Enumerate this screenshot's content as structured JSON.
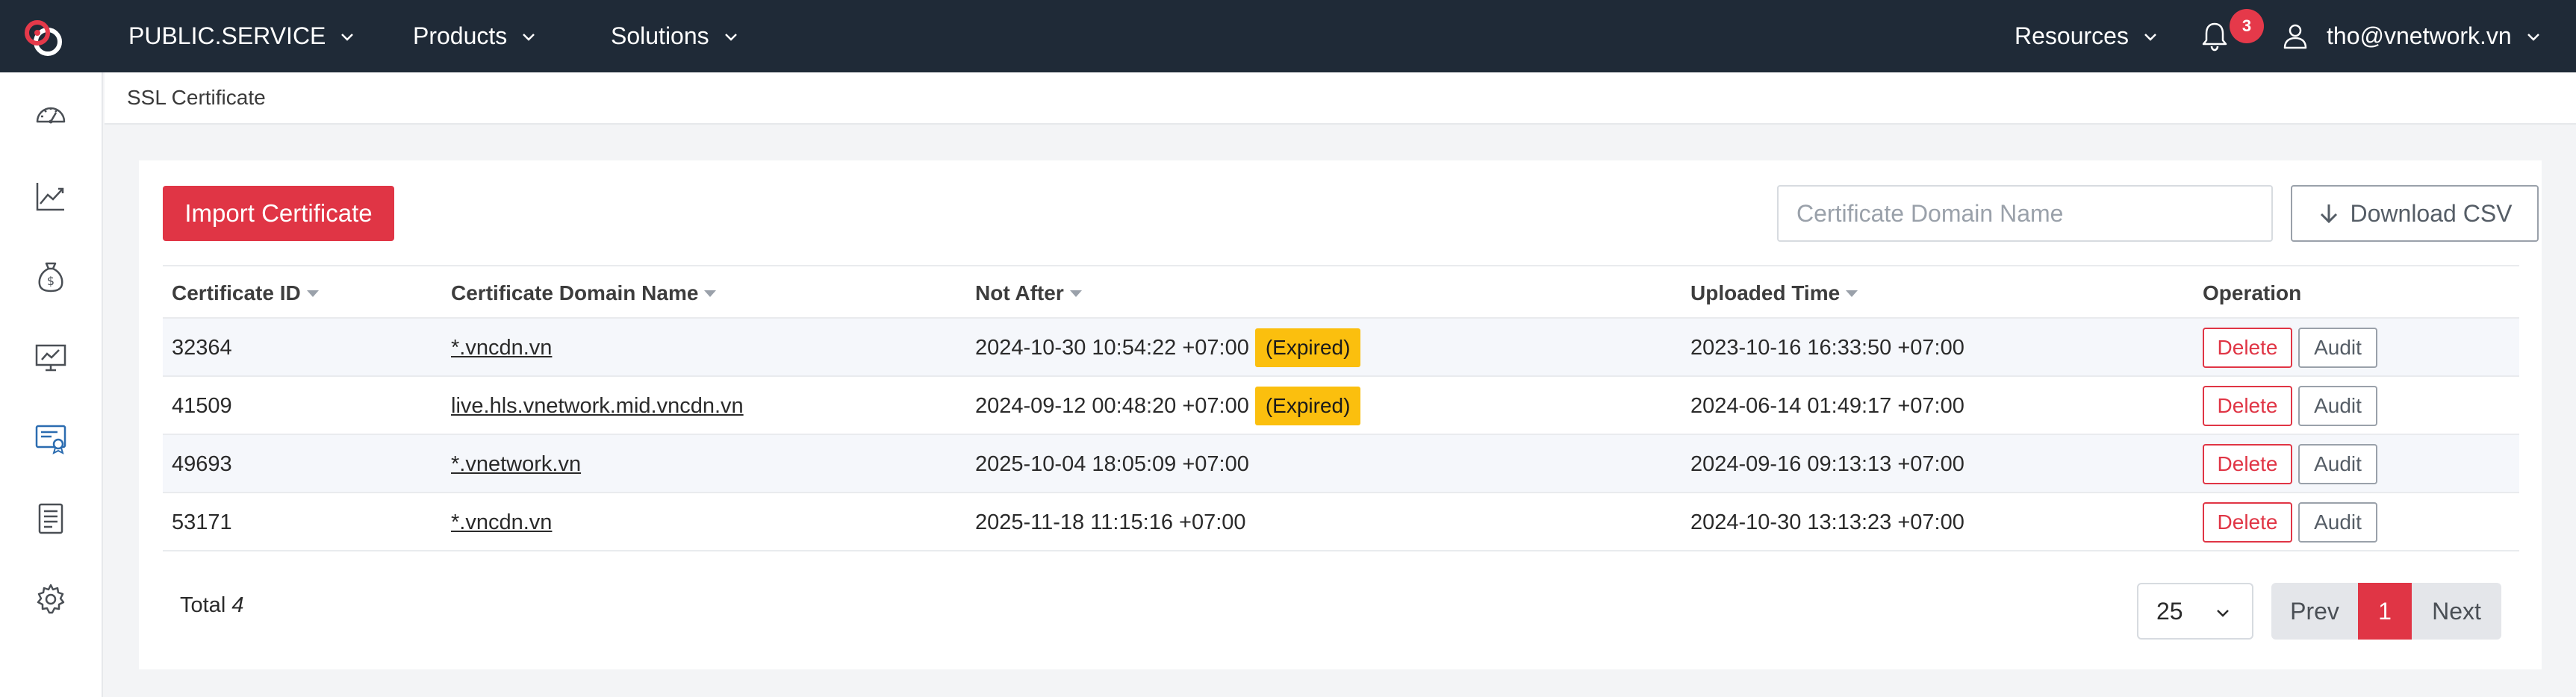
{
  "topbar": {
    "brand": "PUBLIC.SERVICE",
    "nav": [
      "Products",
      "Solutions"
    ],
    "resources": "Resources",
    "notification_count": "3",
    "user_email": "tho@vnetwork.vn"
  },
  "sidebar": {
    "icons": [
      "dashboard-icon",
      "analytics-chart-icon",
      "billing-money-bag-icon",
      "monitor-icon",
      "ssl-certificate-icon",
      "logs-document-icon",
      "settings-gear-icon"
    ],
    "active": "ssl-certificate-icon"
  },
  "breadcrumb": "SSL Certificate",
  "toolbar": {
    "import_label": "Import Certificate",
    "search_placeholder": "Certificate Domain Name",
    "csv_label": "Download CSV"
  },
  "table": {
    "headers": {
      "id": "Certificate ID",
      "domain": "Certificate Domain Name",
      "not_after": "Not After",
      "uploaded": "Uploaded Time",
      "operation": "Operation"
    },
    "rows": [
      {
        "id": "32364",
        "domain": "*.vncdn.vn",
        "not_after": "2024-10-30 10:54:22 +07:00",
        "status": "(Expired)",
        "uploaded": "2023-10-16 16:33:50 +07:00"
      },
      {
        "id": "41509",
        "domain": "live.hls.vnetwork.mid.vncdn.vn",
        "not_after": "2024-09-12 00:48:20 +07:00",
        "status": "(Expired)",
        "uploaded": "2024-06-14 01:49:17 +07:00"
      },
      {
        "id": "49693",
        "domain": "*.vnetwork.vn",
        "not_after": "2025-10-04 18:05:09 +07:00",
        "status": "",
        "uploaded": "2024-09-16 09:13:13 +07:00"
      },
      {
        "id": "53171",
        "domain": "*.vncdn.vn",
        "not_after": "2025-11-18 11:15:16 +07:00",
        "status": "",
        "uploaded": "2024-10-30 13:13:23 +07:00"
      }
    ],
    "delete_label": "Delete",
    "audit_label": "Audit"
  },
  "footer": {
    "total_label": "Total",
    "total_value": "4",
    "page_size": "25",
    "prev_label": "Prev",
    "current_page": "1",
    "next_label": "Next"
  },
  "colors": {
    "topbar": "#1f2a37",
    "accent": "#e03545",
    "expired_badge": "#fbbf0e"
  }
}
